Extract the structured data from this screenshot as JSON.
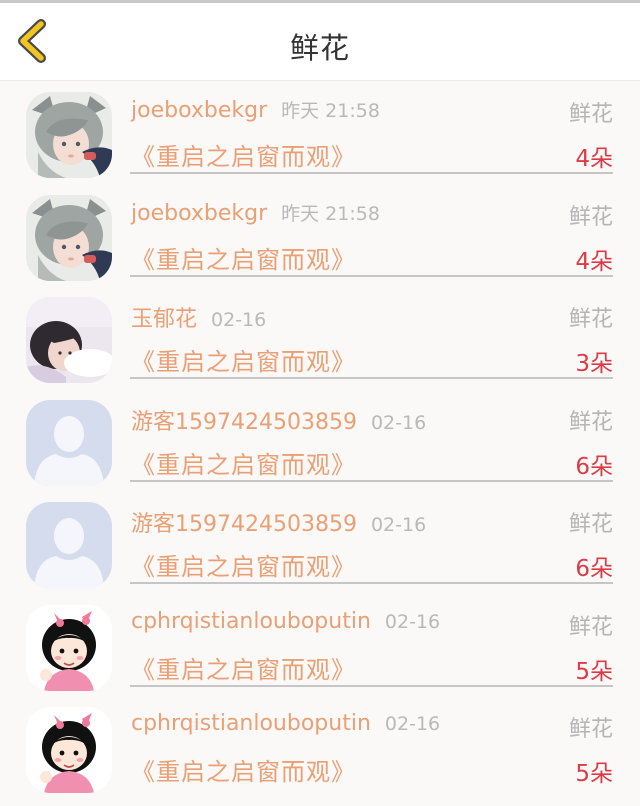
{
  "header": {
    "title": "鲜花",
    "back_icon": "chevron-left-icon",
    "accent_color": "#f2c61f"
  },
  "colors": {
    "username": "#e8a074",
    "timestamp": "#b9b9b9",
    "type_label": "#b5b5b5",
    "count": "#dc3b45"
  },
  "rows": [
    {
      "avatar": "anime-girl-avatar",
      "username": "joeboxbekgr",
      "time": "昨天 21:58",
      "type": "鲜花",
      "book": "《重启之启窗而观》",
      "count": "4朵"
    },
    {
      "avatar": "anime-girl-avatar",
      "username": "joeboxbekgr",
      "time": "昨天 21:58",
      "type": "鲜花",
      "book": "《重启之启窗而观》",
      "count": "4朵"
    },
    {
      "avatar": "photo-avatar",
      "username": "玉郁花",
      "time": "02-16",
      "type": "鲜花",
      "book": "《重启之启窗而观》",
      "count": "3朵"
    },
    {
      "avatar": "default-user-avatar",
      "username": "游客1597424503859",
      "time": "02-16",
      "type": "鲜花",
      "book": "《重启之启窗而观》",
      "count": "6朵"
    },
    {
      "avatar": "default-user-avatar",
      "username": "游客1597424503859",
      "time": "02-16",
      "type": "鲜花",
      "book": "《重启之启窗而观》",
      "count": "6朵"
    },
    {
      "avatar": "cartoon-girl-avatar",
      "username": "cphrqistianlouboputin",
      "time": "02-16",
      "type": "鲜花",
      "book": "《重启之启窗而观》",
      "count": "5朵"
    },
    {
      "avatar": "cartoon-girl-avatar",
      "username": "cphrqistianlouboputin",
      "time": "02-16",
      "type": "鲜花",
      "book": "《重启之启窗而观》",
      "count": "5朵"
    }
  ]
}
